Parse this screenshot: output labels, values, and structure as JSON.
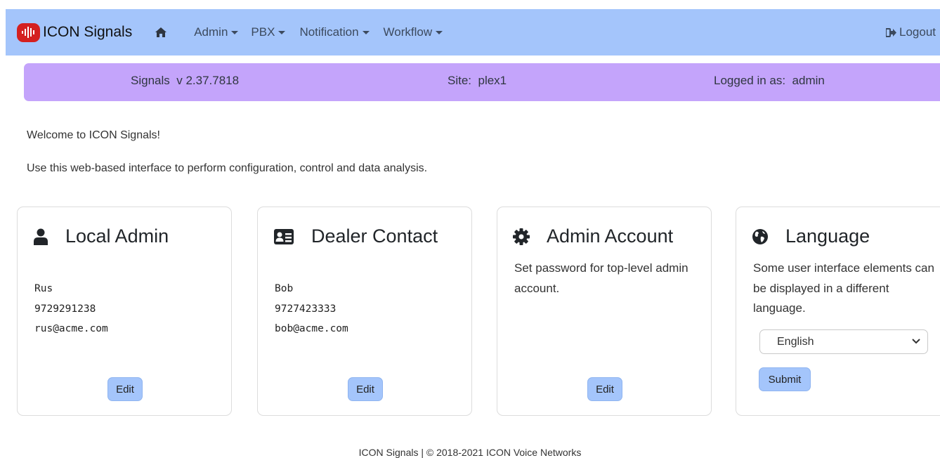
{
  "navbar": {
    "brand": "ICON Signals",
    "menus": [
      {
        "label": "Admin"
      },
      {
        "label": "PBX"
      },
      {
        "label": "Notification"
      },
      {
        "label": "Workflow"
      }
    ],
    "logout": "Logout"
  },
  "info": {
    "signals_label": "Signals",
    "version": "v 2.37.7818",
    "site_label": "Site:",
    "site_value": "plex1",
    "logged_label": "Logged in as:",
    "logged_value": "admin"
  },
  "welcome": "Welcome to ICON Signals!",
  "intro": "Use this web-based interface to perform configuration, control and data analysis.",
  "cards": {
    "local_admin": {
      "title": "Local Admin",
      "name": "Rus",
      "phone": "9729291238",
      "email": "rus@acme.com",
      "button": "Edit"
    },
    "dealer_contact": {
      "title": "Dealer Contact",
      "name": "Bob",
      "phone": "9727423333",
      "email": "bob@acme.com",
      "button": "Edit"
    },
    "admin_account": {
      "title": "Admin Account",
      "description": "Set password for top-level admin account.",
      "button": "Edit"
    },
    "language": {
      "title": "Language",
      "description": "Some user interface elements can be displayed in a different language.",
      "selected": "English",
      "button": "Submit"
    }
  },
  "footer": "ICON Signals | © 2018-2021 ICON Voice Networks",
  "colors": {
    "navbar": "#a4c5fb",
    "infobar": "#c4a4fb",
    "button": "#a4c5fb",
    "logo": "#d42020"
  },
  "icons": [
    "signal-wave-icon",
    "home-icon",
    "user-icon",
    "address-card-icon",
    "gear-icon",
    "globe-icon",
    "logout-icon",
    "chevron-down-icon"
  ]
}
